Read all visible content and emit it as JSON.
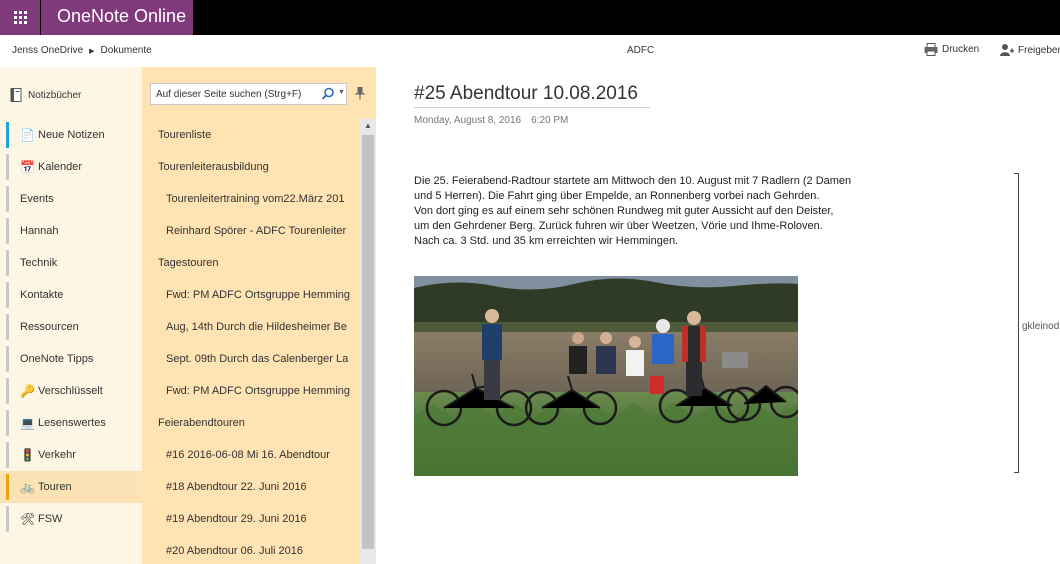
{
  "app": {
    "title": "OneNote Online"
  },
  "breadcrumb": {
    "items": [
      "Jenss OneDrive",
      "Dokumente"
    ]
  },
  "document": {
    "name": "ADFC"
  },
  "toolbar": {
    "print_label": "Drucken",
    "share_label": "Freigeben"
  },
  "notebooks": {
    "label": "Notizbücher"
  },
  "sections": {
    "items": [
      {
        "label": "Neue Notizen",
        "icon": "notes-icon",
        "color": "#1ea3d6",
        "active": false
      },
      {
        "label": "Kalender",
        "icon": "calendar-icon",
        "color": "#c8c8c8",
        "active": false
      },
      {
        "label": "Events",
        "icon": "",
        "color": "#c8c8c8",
        "active": false
      },
      {
        "label": "Hannah",
        "icon": "",
        "color": "#c8c8c8",
        "active": false
      },
      {
        "label": "Technik",
        "icon": "",
        "color": "#c8c8c8",
        "active": false
      },
      {
        "label": "Kontakte",
        "icon": "",
        "color": "#c8c8c8",
        "active": false
      },
      {
        "label": "Ressourcen",
        "icon": "",
        "color": "#c8c8c8",
        "active": false
      },
      {
        "label": "OneNote Tipps",
        "icon": "",
        "color": "#c8c8c8",
        "active": false
      },
      {
        "label": "Verschlüsselt",
        "icon": "key-icon",
        "color": "#c8c8c8",
        "active": false
      },
      {
        "label": "Lesenswertes",
        "icon": "book-icon",
        "color": "#c8c8c8",
        "active": false
      },
      {
        "label": "Verkehr",
        "icon": "traffic-light-icon",
        "color": "#c8c8c8",
        "active": false
      },
      {
        "label": "Touren",
        "icon": "bicycle-icon",
        "color": "#f0a30a",
        "active": true
      },
      {
        "label": "FSW",
        "icon": "tools-icon",
        "color": "#c8c8c8",
        "active": false
      }
    ]
  },
  "search": {
    "placeholder": "Auf dieser Seite suchen (Strg+F)"
  },
  "pages": {
    "items": [
      {
        "label": "Tourenliste",
        "level": 0
      },
      {
        "label": "Tourenleiterausbildung",
        "level": 0
      },
      {
        "label": "Tourenleitertraining vom22.März 201",
        "level": 1
      },
      {
        "label": "Reinhard Spörer - ADFC Tourenleiter",
        "level": 1
      },
      {
        "label": "Tagestouren",
        "level": 0
      },
      {
        "label": "Fwd: PM ADFC Ortsgruppe Hemming",
        "level": 1
      },
      {
        "label": "Aug, 14th Durch die Hildesheimer Be",
        "level": 1
      },
      {
        "label": "Sept. 09th Durch das Calenberger La",
        "level": 1
      },
      {
        "label": "Fwd: PM ADFC Ortsgruppe Hemming",
        "level": 1
      },
      {
        "label": "Feierabendtouren",
        "level": 0
      },
      {
        "label": "#16 2016-06-08 Mi 16. Abendtour",
        "level": 1
      },
      {
        "label": "#18 Abendtour 22. Juni 2016",
        "level": 1
      },
      {
        "label": "#19 Abendtour 29. Juni 2016",
        "level": 1
      },
      {
        "label": "#20 Abendtour 06. Juli 2016",
        "level": 1
      }
    ]
  },
  "page": {
    "title": "#25 Abendtour 10.08.2016",
    "date": "Monday, August 8, 2016",
    "time": "6:20 PM",
    "body_lines": [
      "Die 25. Feierabend-Radtour startete am Mittwoch den 10. August mit 7 Radlern (2 Damen",
      "und 5 Herren). Die Fahrt ging über Empelde, an Ronnenberg vorbei nach Gehrden.",
      "Von dort ging es auf einem sehr schönen Rundweg mit guter Aussicht auf den Deister,",
      "um den Gehrdener Berg. Zurück fuhren wir über Weetzen, Vörie und Ihme-Roloven.",
      "Nach ca. 3 Std. und 35 km erreichten wir Hemmingen."
    ],
    "side_note": "gkleinod"
  },
  "colors": {
    "brand": "#80397b",
    "sections_bg": "#fef6e4",
    "pages_bg": "#ffe3b3",
    "active_section": "#f0a30a"
  }
}
